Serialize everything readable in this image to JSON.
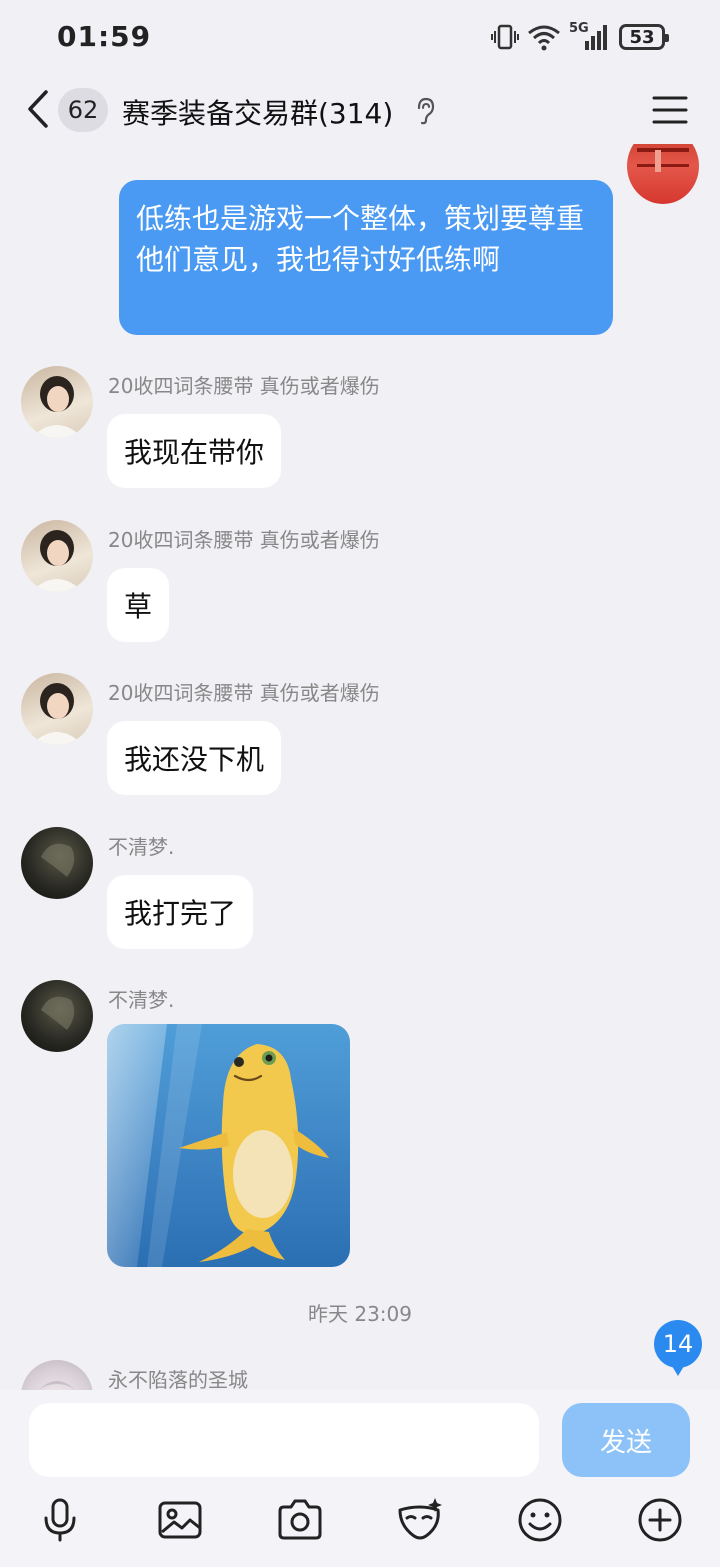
{
  "status_bar": {
    "time": "01:59",
    "network": "5G",
    "battery": "53"
  },
  "header": {
    "back_label": "back",
    "unread_count": "62",
    "title": "赛季装备交易群(314)"
  },
  "messages": {
    "self_message": "低练也是游戏一个整体，策划要尊重他们意见，我也得讨好低练啊",
    "items": [
      {
        "sender": "20收四词条腰带 真伤或者爆伤",
        "text": "我现在带你"
      },
      {
        "sender": "20收四词条腰带 真伤或者爆伤",
        "text": "草"
      },
      {
        "sender": "20收四词条腰带 真伤或者爆伤",
        "text": "我还没下机"
      },
      {
        "sender": "不清梦.",
        "text": "我打完了"
      },
      {
        "sender": "不清梦.",
        "text": ""
      }
    ],
    "timestamp": "昨天 23:09",
    "next_sender": "永不陷落的圣城",
    "new_message_count": "14"
  },
  "input": {
    "placeholder": "",
    "send_label": "发送"
  },
  "toolbar": {
    "icons": [
      "mic-icon",
      "image-icon",
      "camera-icon",
      "mask-icon",
      "emoji-icon",
      "plus-icon"
    ]
  },
  "colors": {
    "self_bubble": "#4a9af4",
    "badge": "#2b8af0",
    "send_disabled": "#8cc2f7",
    "background": "#f0f0f5"
  }
}
